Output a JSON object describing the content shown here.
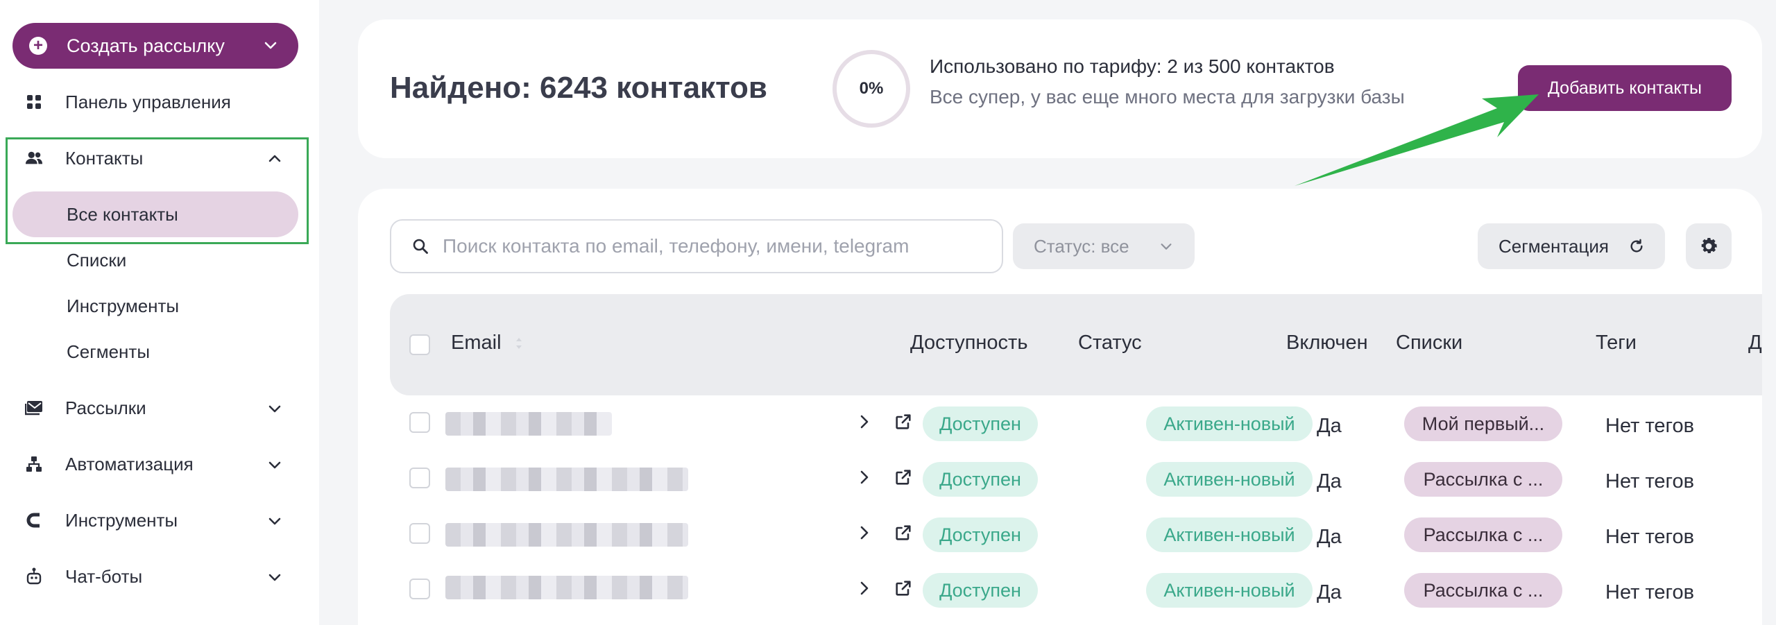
{
  "sidebar": {
    "create_button": "Создать рассылку",
    "items": {
      "dashboard": "Панель управления",
      "contacts": "Контакты",
      "all_contacts": "Все контакты",
      "lists": "Списки",
      "tools_sub": "Инструменты",
      "segments": "Сегменты",
      "mailings": "Рассылки",
      "automation": "Автоматизация",
      "tools": "Инструменты",
      "chatbots": "Чат-боты"
    }
  },
  "header": {
    "found": "Найдено: 6243 контактов",
    "usage_percent": "0%",
    "usage_line1": "Использовано по тарифу: 2 из 500 контактов",
    "usage_line2": "Все супер, у вас еще много места для загрузки базы",
    "add_button": "Добавить контакты"
  },
  "toolbar": {
    "search_placeholder": "Поиск контакта по email, телефону, имени, telegram",
    "status_filter": "Статус: все",
    "segmentation": "Сегментация"
  },
  "table": {
    "columns": {
      "email": "Email",
      "availability": "Доступность",
      "status": "Статус",
      "enabled": "Включен",
      "lists": "Списки",
      "tags": "Теги",
      "extra": "Д"
    },
    "rows": [
      {
        "availability": "Доступен",
        "status": "Активен-новый",
        "enabled": "Да",
        "list": "Мой первый...",
        "tags": "Нет тегов"
      },
      {
        "availability": "Доступен",
        "status": "Активен-новый",
        "enabled": "Да",
        "list": "Рассылка с ...",
        "tags": "Нет тегов"
      },
      {
        "availability": "Доступен",
        "status": "Активен-новый",
        "enabled": "Да",
        "list": "Рассылка с ...",
        "tags": "Нет тегов"
      },
      {
        "availability": "Доступен",
        "status": "Активен-новый",
        "enabled": "Да",
        "list": "Рассылка с ...",
        "tags": "Нет тегов"
      }
    ]
  },
  "colors": {
    "brand": "#7a2c73",
    "brand_light": "#e5d3e3",
    "success_bg": "#dcf3ec",
    "success_text": "#3aa88a",
    "annotation_green": "#2fb34a"
  }
}
